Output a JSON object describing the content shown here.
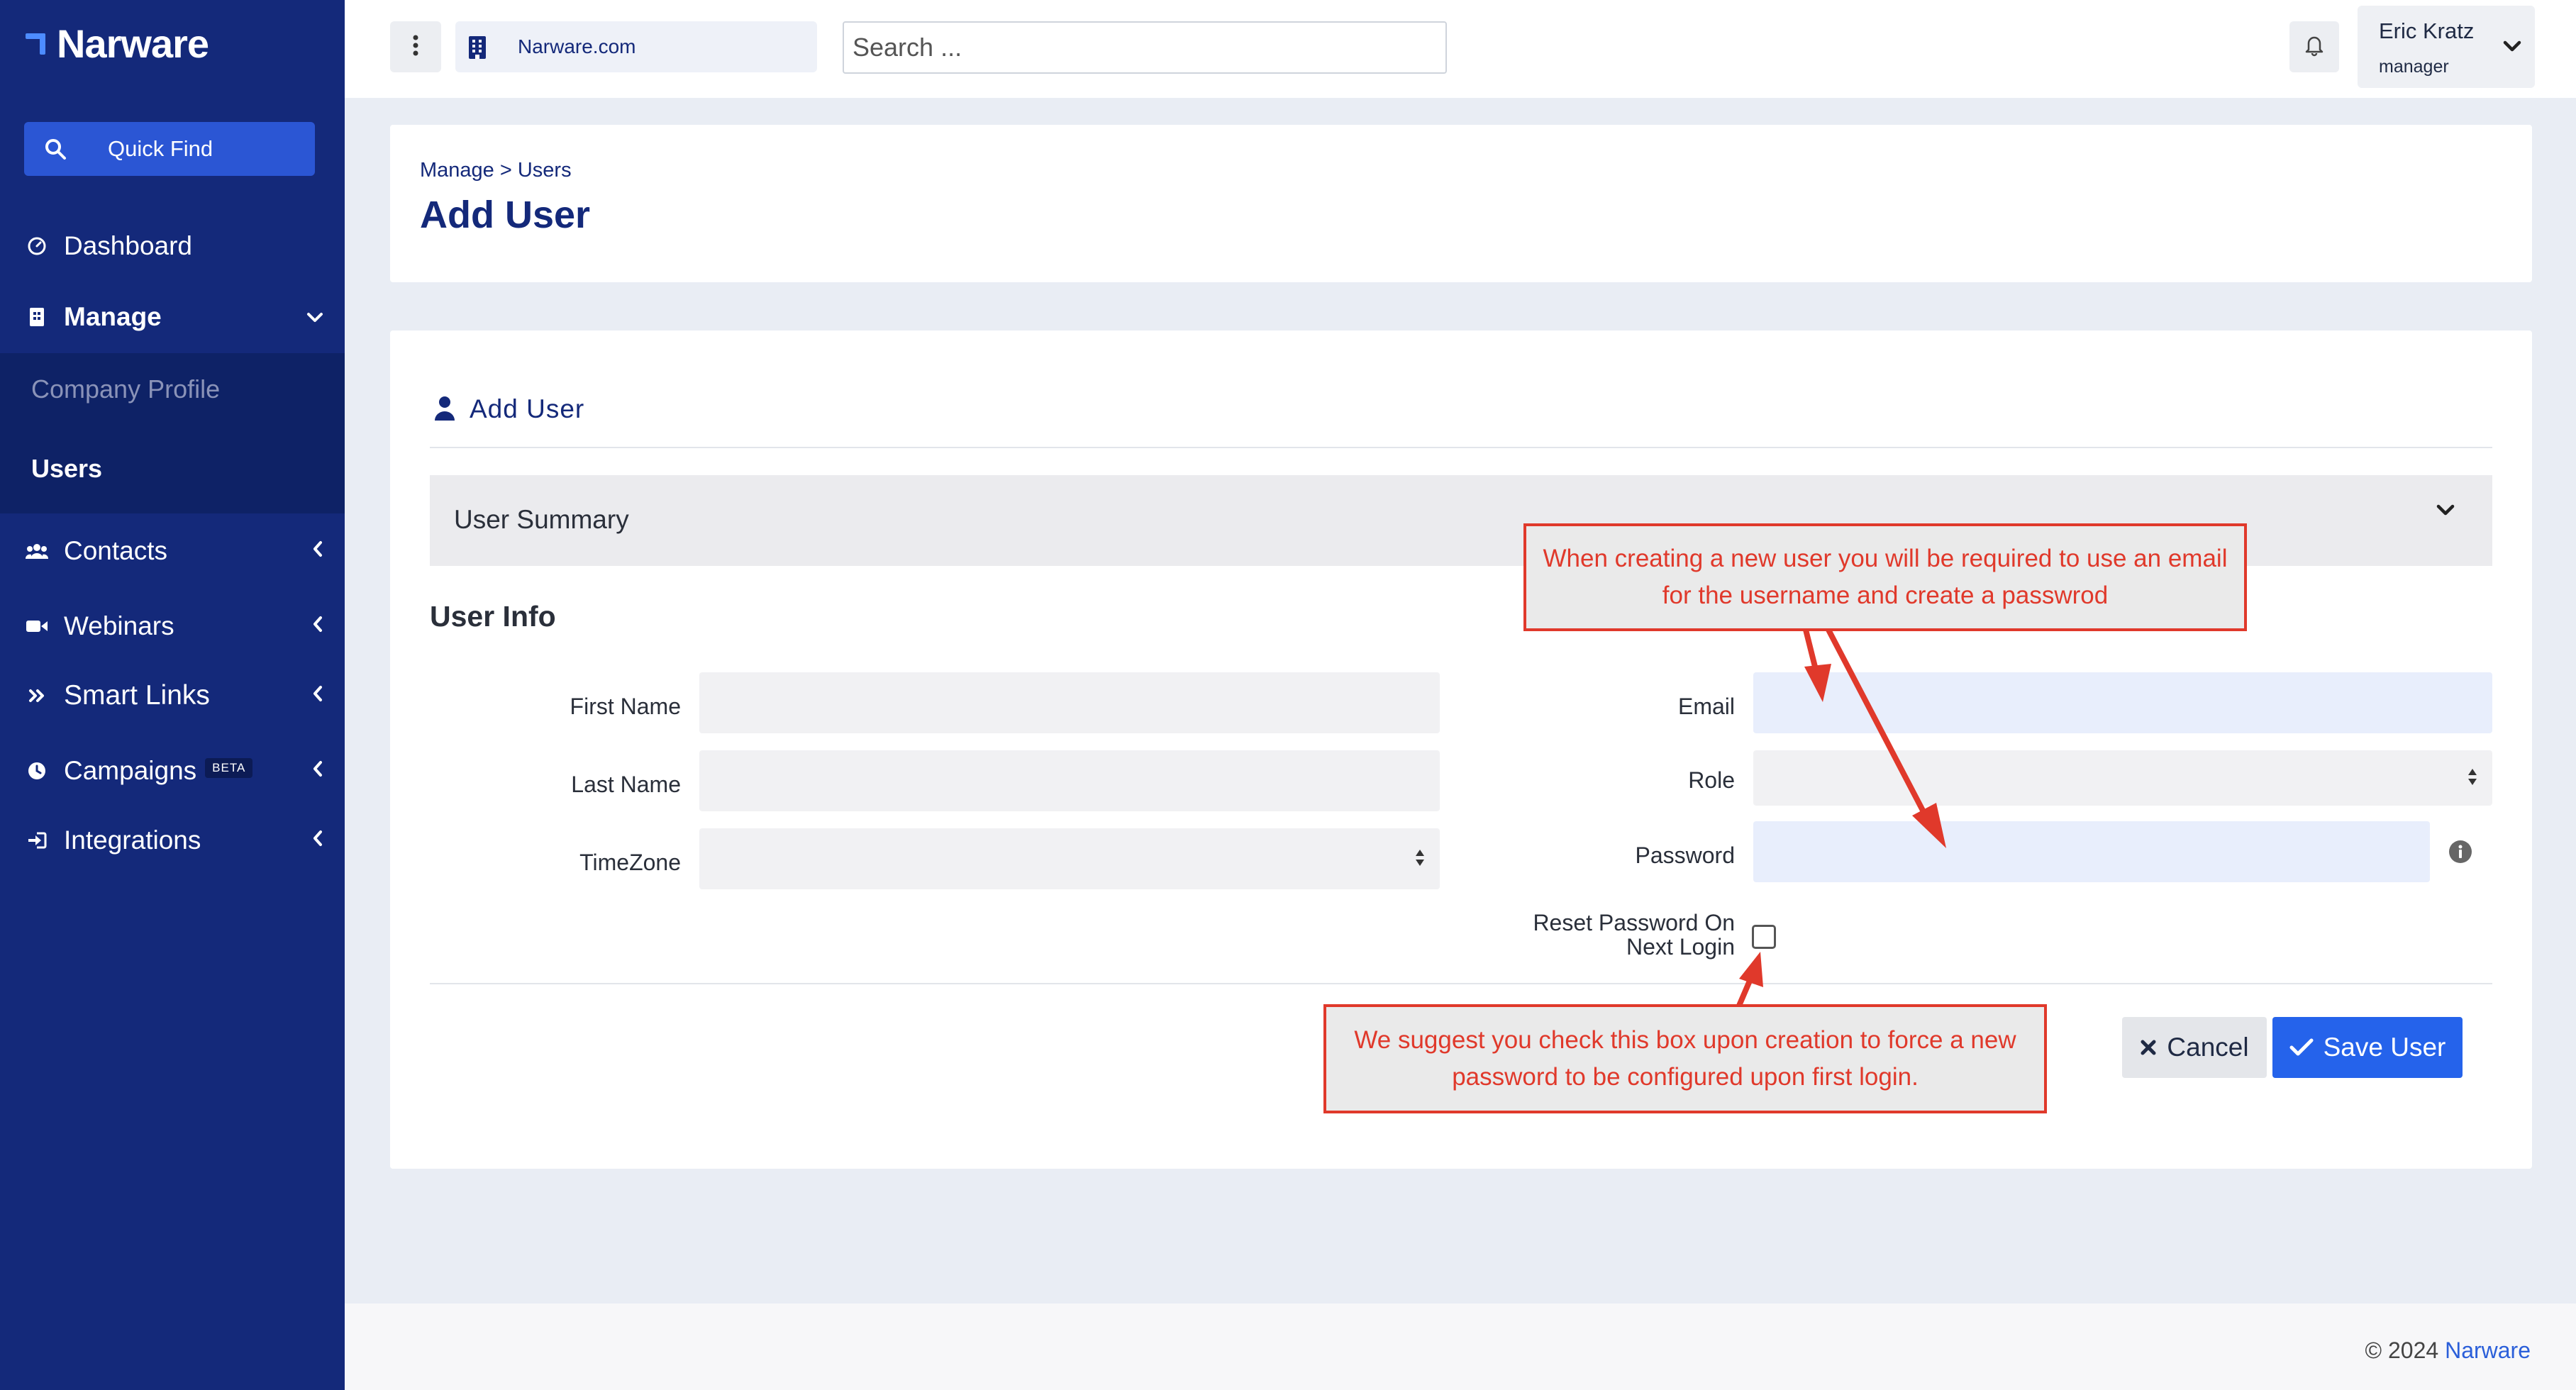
{
  "sidebar": {
    "logo": "Narware",
    "quick_find": "Quick Find",
    "items": [
      {
        "label": "Dashboard"
      },
      {
        "label": "Manage"
      },
      {
        "label": "Contacts"
      },
      {
        "label": "Webinars"
      },
      {
        "label": "Smart Links"
      },
      {
        "label": "Campaigns",
        "badge": "BETA"
      },
      {
        "label": "Integrations"
      }
    ],
    "submenu": [
      {
        "label": "Company Profile"
      },
      {
        "label": "Users"
      }
    ]
  },
  "topbar": {
    "domain": "Narware.com",
    "search_placeholder": "Search ...",
    "user_name": "Eric Kratz",
    "user_role": "manager"
  },
  "header": {
    "breadcrumb": "Manage > Users",
    "title": "Add User"
  },
  "form": {
    "card_title": "Add User",
    "summary_label": "User Summary",
    "section_title": "User Info",
    "labels": {
      "first_name": "First Name",
      "last_name": "Last Name",
      "timezone": "TimeZone",
      "email": "Email",
      "role": "Role",
      "password": "Password",
      "reset_password": "Reset Password On Next Login"
    },
    "values": {
      "first_name": "",
      "last_name": "",
      "timezone": "",
      "email": "",
      "role": "",
      "password": "",
      "reset_password_checked": false
    },
    "cancel_label": "Cancel",
    "save_label": "Save User"
  },
  "annotations": {
    "top": "When creating a new user you will be required to use an email for the username and create a passwrod",
    "bottom": "We suggest you check this box upon creation to force a new password to be configured upon first login.",
    "color": "#e0392b"
  },
  "footer": {
    "copyright": "© 2024",
    "brand": "Narware"
  },
  "colors": {
    "sidebar_bg": "#14297a",
    "accent": "#2563eb",
    "link": "#2b5fd9"
  }
}
